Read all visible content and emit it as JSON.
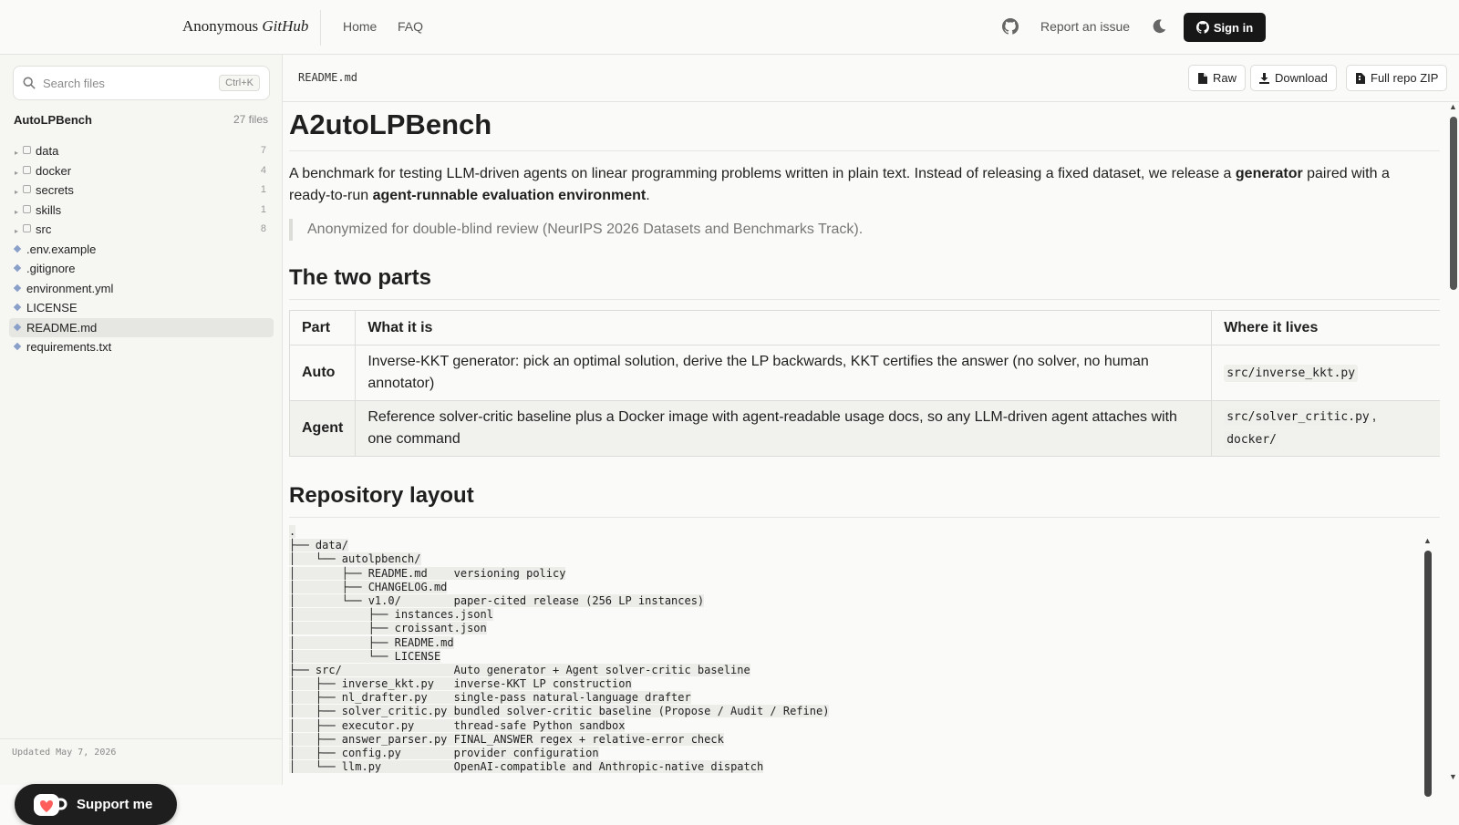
{
  "header": {
    "brand_plain": "Anonymous ",
    "brand_italic": "GitHub",
    "nav": {
      "home": "Home",
      "faq": "FAQ"
    },
    "report": "Report an issue",
    "sign_in": "Sign in"
  },
  "sidebar": {
    "search_placeholder": "Search files",
    "search_shortcut": "Ctrl+K",
    "repo_name": "AutoLPBench",
    "repo_count": "27 files",
    "items": [
      {
        "type": "folder",
        "label": "data",
        "count": "7"
      },
      {
        "type": "folder",
        "label": "docker",
        "count": "4"
      },
      {
        "type": "folder",
        "label": "secrets",
        "count": "1"
      },
      {
        "type": "folder",
        "label": "skills",
        "count": "1"
      },
      {
        "type": "folder",
        "label": "src",
        "count": "8"
      },
      {
        "type": "file",
        "label": ".env.example"
      },
      {
        "type": "file",
        "label": ".gitignore"
      },
      {
        "type": "file",
        "label": "environment.yml"
      },
      {
        "type": "file",
        "label": "LICENSE"
      },
      {
        "type": "file",
        "label": "README.md",
        "active": true
      },
      {
        "type": "file",
        "label": "requirements.txt"
      }
    ],
    "updated": "Updated May 7, 2026",
    "support": "Support me"
  },
  "file": {
    "name": "README.md",
    "buttons": {
      "raw": "Raw",
      "download": "Download",
      "zip": "Full repo ZIP"
    }
  },
  "readme": {
    "title": "A2utoLPBench",
    "intro": {
      "p1": "A benchmark for testing LLM-driven agents on linear programming problems written in plain text. Instead of releasing a fixed dataset, we release a ",
      "b1": "generator",
      "p2": " paired with a ready-to-run ",
      "b2": "agent-runnable evaluation environment",
      "p3": "."
    },
    "quote": "Anonymized for double-blind review (NeurIPS 2026 Datasets and Benchmarks Track).",
    "h2_parts": "The two parts",
    "table": {
      "headers": [
        "Part",
        "What it is",
        "Where it lives"
      ],
      "rows": [
        {
          "part": "Auto",
          "what": "Inverse-KKT generator: pick an optimal solution, derive the LP backwards, KKT certifies the answer (no solver, no human annotator)",
          "where1": "src/inverse_kkt.py",
          "sep": "",
          "where2": ""
        },
        {
          "part": "Agent",
          "what": "Reference solver-critic baseline plus a Docker image with agent-readable usage docs, so any LLM-driven agent attaches with one command",
          "where1": "src/solver_critic.py",
          "sep": ",",
          "where2": "docker/"
        }
      ]
    },
    "h2_layout": "Repository layout",
    "layout_lines": [
      {
        "tree": ".",
        "desc": ""
      },
      {
        "tree": "├── data/",
        "desc": ""
      },
      {
        "tree": "│   └── autolpbench/",
        "desc": ""
      },
      {
        "tree": "│       ├── README.md",
        "desc": "versioning policy"
      },
      {
        "tree": "│       ├── CHANGELOG.md",
        "desc": ""
      },
      {
        "tree": "│       └── v1.0/",
        "desc": "paper-cited release (256 LP instances)"
      },
      {
        "tree": "│           ├── instances.jsonl",
        "desc": ""
      },
      {
        "tree": "│           ├── croissant.json",
        "desc": ""
      },
      {
        "tree": "│           ├── README.md",
        "desc": ""
      },
      {
        "tree": "│           └── LICENSE",
        "desc": ""
      },
      {
        "tree": "├── src/",
        "desc": "Auto generator + Agent solver-critic baseline"
      },
      {
        "tree": "│   ├── inverse_kkt.py",
        "desc": "inverse-KKT LP construction"
      },
      {
        "tree": "│   ├── nl_drafter.py",
        "desc": "single-pass natural-language drafter"
      },
      {
        "tree": "│   ├── solver_critic.py",
        "desc": "bundled solver-critic baseline (Propose / Audit / Refine)"
      },
      {
        "tree": "│   ├── executor.py",
        "desc": "thread-safe Python sandbox"
      },
      {
        "tree": "│   ├── answer_parser.py",
        "desc": "FINAL_ANSWER regex + relative-error check"
      },
      {
        "tree": "│   ├── config.py",
        "desc": "provider configuration"
      },
      {
        "tree": "│   └── llm.py",
        "desc": "OpenAI-compatible and Anthropic-native dispatch"
      }
    ]
  }
}
